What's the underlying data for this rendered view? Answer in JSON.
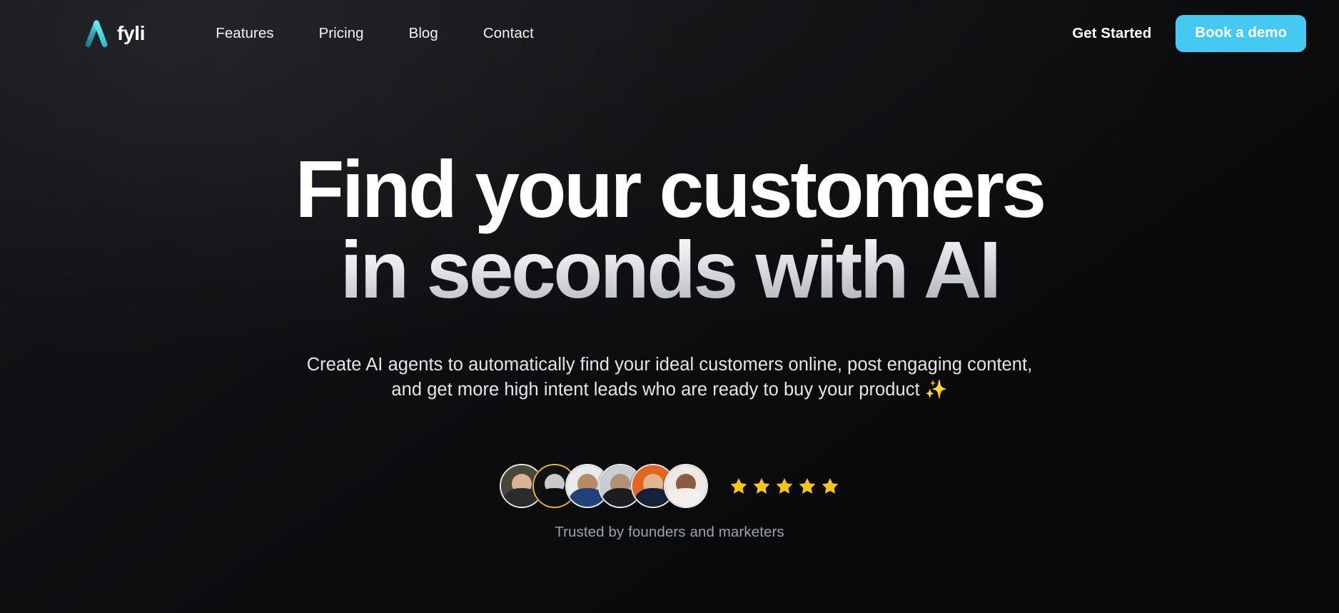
{
  "theme": {
    "background": "#08090b",
    "accent": "#45c8f2",
    "star_color": "#f5c518",
    "logo_gradient_from": "#5fe3e8",
    "logo_gradient_to": "#1f7f8c",
    "muted_text": "#9ca2aa"
  },
  "navbar": {
    "brand": {
      "name": "fyli",
      "logo_icon": "lambda-chevron-icon"
    },
    "links": [
      {
        "label": "Features"
      },
      {
        "label": "Pricing"
      },
      {
        "label": "Blog"
      },
      {
        "label": "Contact"
      }
    ],
    "get_started_label": "Get Started",
    "book_demo_label": "Book a demo"
  },
  "hero": {
    "headline_line_1": "Find your customers",
    "headline_line_2": "in seconds with AI",
    "subtitle": "Create AI agents to automatically find your ideal customers online, post engaging content, and get more high intent leads who are ready to buy your product ✨",
    "social_proof": {
      "avatars": [
        {
          "alt": "founder-avatar-1",
          "ring": "white",
          "bg": "#4a4638",
          "skin": "#d9b392",
          "shirt": "#2a2b2d"
        },
        {
          "alt": "founder-avatar-2",
          "ring": "gold",
          "bg": "#111214",
          "skin": "#c9c9c9",
          "shirt": "#0d0e10"
        },
        {
          "alt": "founder-avatar-3",
          "ring": "white",
          "bg": "#e9eaec",
          "skin": "#b98a63",
          "shirt": "#23407a"
        },
        {
          "alt": "founder-avatar-4",
          "ring": "white",
          "bg": "#c9ccd0",
          "skin": "#b59077",
          "shirt": "#1c1d20"
        },
        {
          "alt": "founder-avatar-5",
          "ring": "white",
          "bg": "#e2661f",
          "skin": "#e3b492",
          "shirt": "#15203a"
        },
        {
          "alt": "founder-avatar-6",
          "ring": "white",
          "bg": "#efe9e6",
          "skin": "#8a5c41",
          "shirt": "#f3eeeb"
        }
      ],
      "star_count": 5,
      "star_icon": "star-icon",
      "trust_text": "Trusted by founders and marketers"
    }
  }
}
